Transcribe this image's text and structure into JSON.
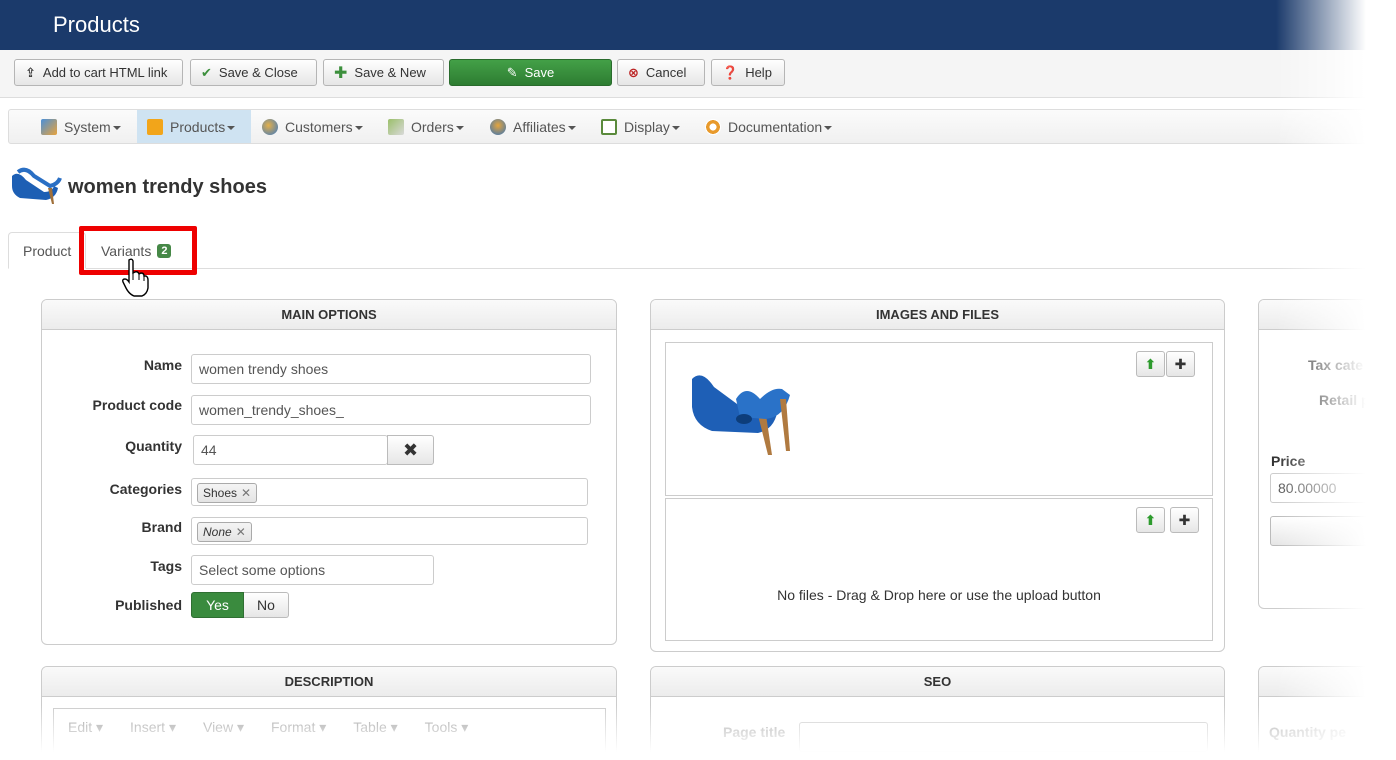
{
  "header": {
    "title": "Products"
  },
  "toolbar": {
    "add_cart_label": "Add to cart HTML link",
    "save_close_label": "Save & Close",
    "save_new_label": "Save & New",
    "save_label": "Save",
    "cancel_label": "Cancel",
    "help_label": "Help"
  },
  "menu": {
    "items": [
      {
        "label": "System"
      },
      {
        "label": "Products"
      },
      {
        "label": "Customers"
      },
      {
        "label": "Orders"
      },
      {
        "label": "Affiliates"
      },
      {
        "label": "Display"
      },
      {
        "label": "Documentation"
      }
    ],
    "active": "Products"
  },
  "product": {
    "title": "women trendy shoes"
  },
  "tabs": [
    {
      "label": "Product"
    },
    {
      "label": "Variants",
      "badge": "2"
    }
  ],
  "main_options": {
    "title": "MAIN OPTIONS",
    "name_label": "Name",
    "name_value": "women trendy shoes",
    "code_label": "Product code",
    "code_value": "women_trendy_shoes_",
    "quantity_label": "Quantity",
    "quantity_value": "44",
    "categories_label": "Categories",
    "categories_chip": "Shoes",
    "brand_label": "Brand",
    "brand_chip": "None",
    "tags_label": "Tags",
    "tags_placeholder": "Select some options",
    "published_label": "Published",
    "yes_label": "Yes",
    "no_label": "No"
  },
  "images_files": {
    "title": "IMAGES AND FILES",
    "no_files_text": "No files - Drag & Drop here or use the upload button"
  },
  "price_panel": {
    "tax_label": "Tax cate",
    "retail_label": "Retail p",
    "price_label": "Price",
    "price_value": "80.00000"
  },
  "description": {
    "title": "DESCRIPTION",
    "editor_menu": [
      "Edit",
      "Insert",
      "View",
      "Format",
      "Table",
      "Tools"
    ]
  },
  "seo": {
    "title": "SEO",
    "page_title_label": "Page title"
  },
  "third_bottom": {
    "quantity_label": "Quantity pe"
  },
  "colors": {
    "header_bg": "#1b3a6b",
    "save_green": "#3a8b3e",
    "highlight_red": "#ee0000",
    "badge_green": "#468847"
  }
}
